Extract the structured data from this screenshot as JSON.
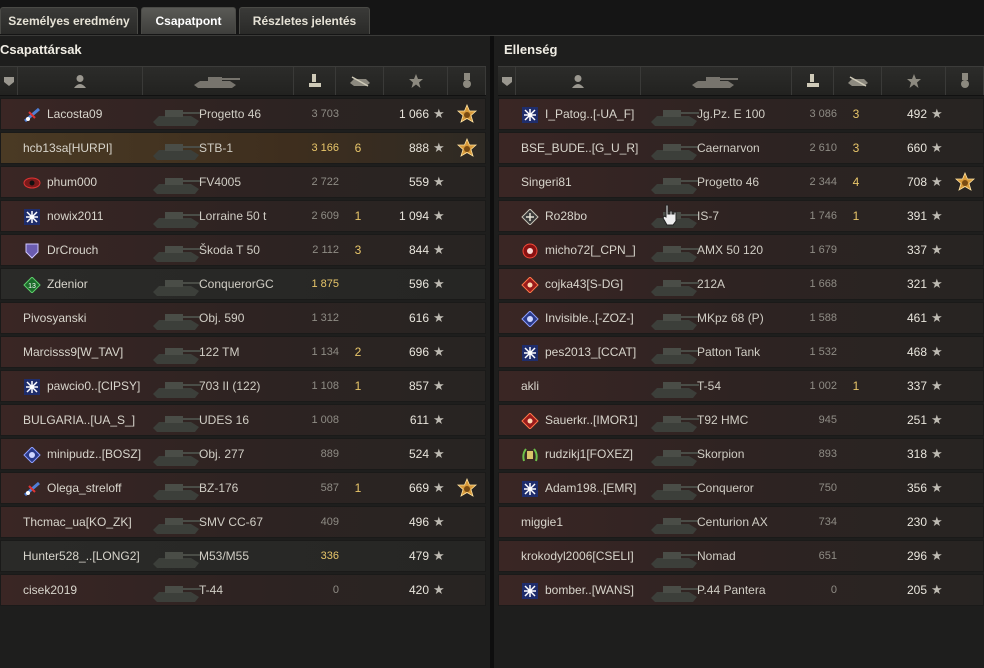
{
  "tabs": [
    {
      "label": "Személyes eredmény",
      "active": false
    },
    {
      "label": "Csapatpont",
      "active": true
    },
    {
      "label": "Részletes jelentés",
      "active": false
    }
  ],
  "left": {
    "title": "Csapattársak",
    "rows": [
      {
        "name": "Lacosta09",
        "clan_icon": "plane-icon",
        "tank": "Progetto 46",
        "damage": "3 703",
        "dmg_hi": false,
        "kills": "",
        "xp": "1 066",
        "medal": true,
        "style": "red"
      },
      {
        "name": "hcb13sa[HURPI]",
        "clan_icon": "",
        "tank": "STB-1",
        "damage": "3 166",
        "dmg_hi": true,
        "kills": "6",
        "xp": "888",
        "medal": true,
        "style": "own"
      },
      {
        "name": "phum000",
        "clan_icon": "eye-icon",
        "tank": "FV4005",
        "damage": "2 722",
        "dmg_hi": false,
        "kills": "",
        "xp": "559",
        "medal": false,
        "style": "red"
      },
      {
        "name": "nowix2011",
        "clan_icon": "snowflake-icon",
        "tank": "Lorraine 50 t",
        "damage": "2 609",
        "dmg_hi": false,
        "kills": "1",
        "xp": "1 094",
        "medal": false,
        "style": "red"
      },
      {
        "name": "DrCrouch",
        "clan_icon": "shield-icon",
        "tank": "Škoda T 50",
        "damage": "2 112",
        "dmg_hi": false,
        "kills": "3",
        "xp": "844",
        "medal": false,
        "style": "red"
      },
      {
        "name": "Zdenior",
        "clan_icon": "diamond-13-icon",
        "tank": "ConquerorGC",
        "damage": "1 875",
        "dmg_hi": true,
        "kills": "",
        "xp": "596",
        "medal": false,
        "style": "normal"
      },
      {
        "name": "Pivosyanski",
        "clan_icon": "",
        "tank": "Obj. 590",
        "damage": "1 312",
        "dmg_hi": false,
        "kills": "",
        "xp": "616",
        "medal": false,
        "style": "red"
      },
      {
        "name": "Marcisss9[W_TAV]",
        "clan_icon": "",
        "tank": "122 TM",
        "damage": "1 134",
        "dmg_hi": false,
        "kills": "2",
        "xp": "696",
        "medal": false,
        "style": "red"
      },
      {
        "name": "pawcio0..[CIPSY]",
        "clan_icon": "snowflake-icon",
        "tank": "703 II (122)",
        "damage": "1 108",
        "dmg_hi": false,
        "kills": "1",
        "xp": "857",
        "medal": false,
        "style": "red"
      },
      {
        "name": "BULGARIA..[UA_S_]",
        "clan_icon": "",
        "tank": "UDES 16",
        "damage": "1 008",
        "dmg_hi": false,
        "kills": "",
        "xp": "611",
        "medal": false,
        "style": "red"
      },
      {
        "name": "minipudz..[BOSZ]",
        "clan_icon": "badge-icon",
        "tank": "Obj. 277",
        "damage": "889",
        "dmg_hi": false,
        "kills": "",
        "xp": "524",
        "medal": false,
        "style": "red"
      },
      {
        "name": "Olega_streloff",
        "clan_icon": "plane-icon",
        "tank": "BZ-176",
        "damage": "587",
        "dmg_hi": false,
        "kills": "1",
        "xp": "669",
        "medal": true,
        "style": "red"
      },
      {
        "name": "Thcmac_ua[KO_ZK]",
        "clan_icon": "",
        "tank": "SMV CC-67",
        "damage": "409",
        "dmg_hi": false,
        "kills": "",
        "xp": "496",
        "medal": false,
        "style": "red"
      },
      {
        "name": "Hunter528_..[LONG2]",
        "clan_icon": "",
        "tank": "M53/M55",
        "damage": "336",
        "dmg_hi": true,
        "kills": "",
        "xp": "479",
        "medal": false,
        "style": "normal"
      },
      {
        "name": "cisek2019",
        "clan_icon": "",
        "tank": "T-44",
        "damage": "0",
        "dmg_hi": false,
        "kills": "",
        "xp": "420",
        "medal": false,
        "style": "red"
      }
    ]
  },
  "right": {
    "title": "Ellenség",
    "rows": [
      {
        "name": "I_Patog..[-UA_F]",
        "clan_icon": "snowflake-icon",
        "tank": "Jg.Pz. E 100",
        "damage": "3 086",
        "dmg_hi": false,
        "kills": "3",
        "xp": "492",
        "medal": false,
        "style": "red"
      },
      {
        "name": "BSE_BUDE..[G_U_R]",
        "clan_icon": "",
        "tank": "Caernarvon",
        "damage": "2 610",
        "dmg_hi": false,
        "kills": "3",
        "xp": "660",
        "medal": false,
        "style": "red"
      },
      {
        "name": "Singeri81",
        "clan_icon": "",
        "tank": "Progetto 46",
        "damage": "2 344",
        "dmg_hi": false,
        "kills": "4",
        "xp": "708",
        "medal": true,
        "style": "red"
      },
      {
        "name": "Ro28bo",
        "clan_icon": "cross-icon",
        "tank": "IS-7",
        "damage": "1 746",
        "dmg_hi": false,
        "kills": "1",
        "xp": "391",
        "medal": false,
        "style": "red"
      },
      {
        "name": "micho72[_CPN_]",
        "clan_icon": "red-circle-icon",
        "tank": "AMX 50 120",
        "damage": "1 679",
        "dmg_hi": false,
        "kills": "",
        "xp": "337",
        "medal": false,
        "style": "red"
      },
      {
        "name": "cojka43[S-DG]",
        "clan_icon": "red-diamond-icon",
        "tank": "212A",
        "damage": "1 668",
        "dmg_hi": false,
        "kills": "",
        "xp": "321",
        "medal": false,
        "style": "red"
      },
      {
        "name": "Invisible..[-ZOZ-]",
        "clan_icon": "badge-icon",
        "tank": "MKpz 68 (P)",
        "damage": "1 588",
        "dmg_hi": false,
        "kills": "",
        "xp": "461",
        "medal": false,
        "style": "red"
      },
      {
        "name": "pes2013_[CCAT]",
        "clan_icon": "snowflake-icon",
        "tank": "Patton Tank",
        "damage": "1 532",
        "dmg_hi": false,
        "kills": "",
        "xp": "468",
        "medal": false,
        "style": "red"
      },
      {
        "name": "akli",
        "clan_icon": "",
        "tank": "T-54",
        "damage": "1 002",
        "dmg_hi": false,
        "kills": "1",
        "xp": "337",
        "medal": false,
        "style": "red"
      },
      {
        "name": "Sauerkr..[IMOR1]",
        "clan_icon": "red-diamond-icon",
        "tank": "T92 HMC",
        "damage": "945",
        "dmg_hi": false,
        "kills": "",
        "xp": "251",
        "medal": false,
        "style": "red"
      },
      {
        "name": "rudzikj1[FOXEZ]",
        "clan_icon": "laurel-icon",
        "tank": "Skorpion",
        "damage": "893",
        "dmg_hi": false,
        "kills": "",
        "xp": "318",
        "medal": false,
        "style": "red"
      },
      {
        "name": "Adam198..[EMR]",
        "clan_icon": "snowflake-icon",
        "tank": "Conqueror",
        "damage": "750",
        "dmg_hi": false,
        "kills": "",
        "xp": "356",
        "medal": false,
        "style": "red"
      },
      {
        "name": "miggie1",
        "clan_icon": "",
        "tank": "Centurion AX",
        "damage": "734",
        "dmg_hi": false,
        "kills": "",
        "xp": "230",
        "medal": false,
        "style": "red"
      },
      {
        "name": "krokodyl2006[CSELI]",
        "clan_icon": "",
        "tank": "Nomad",
        "damage": "651",
        "dmg_hi": false,
        "kills": "",
        "xp": "296",
        "medal": false,
        "style": "red"
      },
      {
        "name": "bomber..[WANS]",
        "clan_icon": "snowflake-icon",
        "tank": "P.44 Pantera",
        "damage": "0",
        "dmg_hi": false,
        "kills": "",
        "xp": "205",
        "medal": false,
        "style": "red"
      }
    ]
  },
  "colors": {
    "accent": "#e8c66a",
    "medal": "#d89a3a"
  }
}
